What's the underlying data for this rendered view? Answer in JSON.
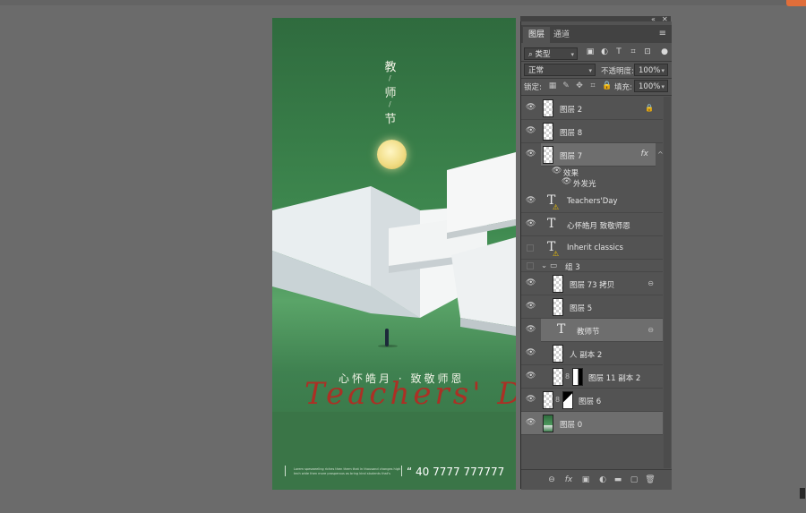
{
  "poster": {
    "title_chars": [
      "教",
      "师",
      "节"
    ],
    "slash": "/",
    "subtitle": "心怀皓月 · 致敬师恩",
    "script_text": "Teachers' Day",
    "small_text": "Lorem spesweeling riches then them that in thousand changes high tech wide then more prosperous as bring kind students that's",
    "phone": "40 7777 777777",
    "phone_prefix": "“"
  },
  "panel": {
    "tabs": [
      {
        "label": "图层"
      },
      {
        "label": "通道"
      }
    ],
    "menu_icon": "≡",
    "filter": {
      "value": "类型",
      "icon": "search-icon"
    },
    "blend_mode": "正常",
    "opacity_label": "不透明度:",
    "opacity_value": "100%",
    "lock_label": "锁定:",
    "fill_label": "填充:",
    "fill_value": "100%",
    "layers": [
      {
        "name": "图层 2",
        "type": "pixel",
        "right_icon": "lock-icon"
      },
      {
        "name": "图层 8",
        "type": "pixel"
      },
      {
        "name": "图层 7",
        "type": "pixel",
        "selected": true,
        "fx": "fx"
      },
      {
        "name": "效果",
        "type": "effect-header"
      },
      {
        "name": "外发光",
        "type": "effect"
      },
      {
        "name": "Teachers'Day",
        "type": "text",
        "warning": true
      },
      {
        "name": "心怀皓月 致敬师恩",
        "type": "text"
      },
      {
        "name": "Inherit classics",
        "type": "text",
        "warning": true,
        "hidden": true
      },
      {
        "name": "组 3",
        "type": "group"
      },
      {
        "name": "图层 73 拷贝",
        "type": "pixel",
        "linked": true
      },
      {
        "name": "图层 5",
        "type": "pixel"
      },
      {
        "name": "教师节",
        "type": "text",
        "selected": true,
        "linked": true
      },
      {
        "name": "人 副本 2",
        "type": "pixel"
      },
      {
        "name": "图层 11 副本 2",
        "type": "mask"
      },
      {
        "name": "图层 6",
        "type": "mask"
      },
      {
        "name": "图层 0",
        "type": "photo",
        "selected": true
      }
    ],
    "bottom_icons": [
      "link-icon",
      "fx-icon",
      "mask-icon",
      "adjustment-icon",
      "folder-icon",
      "new-layer-icon",
      "trash-icon"
    ],
    "bottom_glyphs": [
      "⊖",
      "fx",
      "▣",
      "◐",
      "▬",
      "▢",
      "🗑"
    ]
  },
  "colors": {
    "workspace": "#6b6b6b",
    "panel": "#535353",
    "selected_row": "#6e6e6e",
    "poster_green": "#3f8a50",
    "script_red": "#b52a22"
  }
}
